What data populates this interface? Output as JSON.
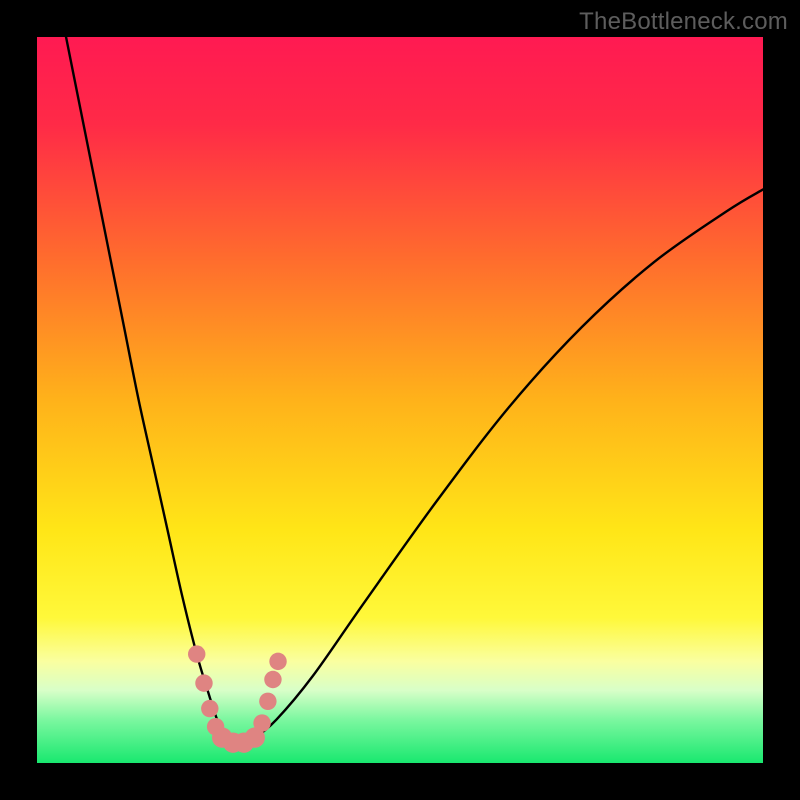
{
  "watermark": "TheBottleneck.com",
  "chart_data": {
    "type": "line",
    "title": "",
    "xlabel": "",
    "ylabel": "",
    "xlim": [
      0,
      100
    ],
    "ylim": [
      0,
      100
    ],
    "gradient": {
      "stops": [
        {
          "pos": 0,
          "color": "#ff1a52"
        },
        {
          "pos": 0.12,
          "color": "#ff2a47"
        },
        {
          "pos": 0.3,
          "color": "#ff6a2e"
        },
        {
          "pos": 0.5,
          "color": "#ffb21a"
        },
        {
          "pos": 0.68,
          "color": "#ffe617"
        },
        {
          "pos": 0.8,
          "color": "#fff83a"
        },
        {
          "pos": 0.86,
          "color": "#faffa0"
        },
        {
          "pos": 0.9,
          "color": "#d8ffc8"
        },
        {
          "pos": 0.94,
          "color": "#7cf7a0"
        },
        {
          "pos": 1.0,
          "color": "#19e86f"
        }
      ]
    },
    "series": [
      {
        "name": "bottleneck-curve",
        "x": [
          4,
          6,
          8,
          10,
          12,
          14,
          16,
          18,
          20,
          22,
          23.5,
          25,
          26.5,
          28,
          30,
          33,
          38,
          45,
          55,
          65,
          75,
          85,
          95,
          100
        ],
        "y": [
          100,
          90,
          80,
          70,
          60,
          50,
          41,
          32,
          23,
          15,
          10,
          5.5,
          3,
          2.5,
          3.5,
          6,
          12,
          22,
          36,
          49,
          60,
          69,
          76,
          79
        ]
      }
    ],
    "markers": [
      {
        "x": 22.0,
        "y": 15.0,
        "r": 1.2
      },
      {
        "x": 23.0,
        "y": 11.0,
        "r": 1.2
      },
      {
        "x": 23.8,
        "y": 7.5,
        "r": 1.2
      },
      {
        "x": 24.6,
        "y": 5.0,
        "r": 1.2
      },
      {
        "x": 25.5,
        "y": 3.5,
        "r": 1.4
      },
      {
        "x": 27.0,
        "y": 2.8,
        "r": 1.4
      },
      {
        "x": 28.5,
        "y": 2.8,
        "r": 1.4
      },
      {
        "x": 30.0,
        "y": 3.5,
        "r": 1.4
      },
      {
        "x": 31.0,
        "y": 5.5,
        "r": 1.2
      },
      {
        "x": 31.8,
        "y": 8.5,
        "r": 1.2
      },
      {
        "x": 32.5,
        "y": 11.5,
        "r": 1.2
      },
      {
        "x": 33.2,
        "y": 14.0,
        "r": 1.2
      }
    ]
  }
}
